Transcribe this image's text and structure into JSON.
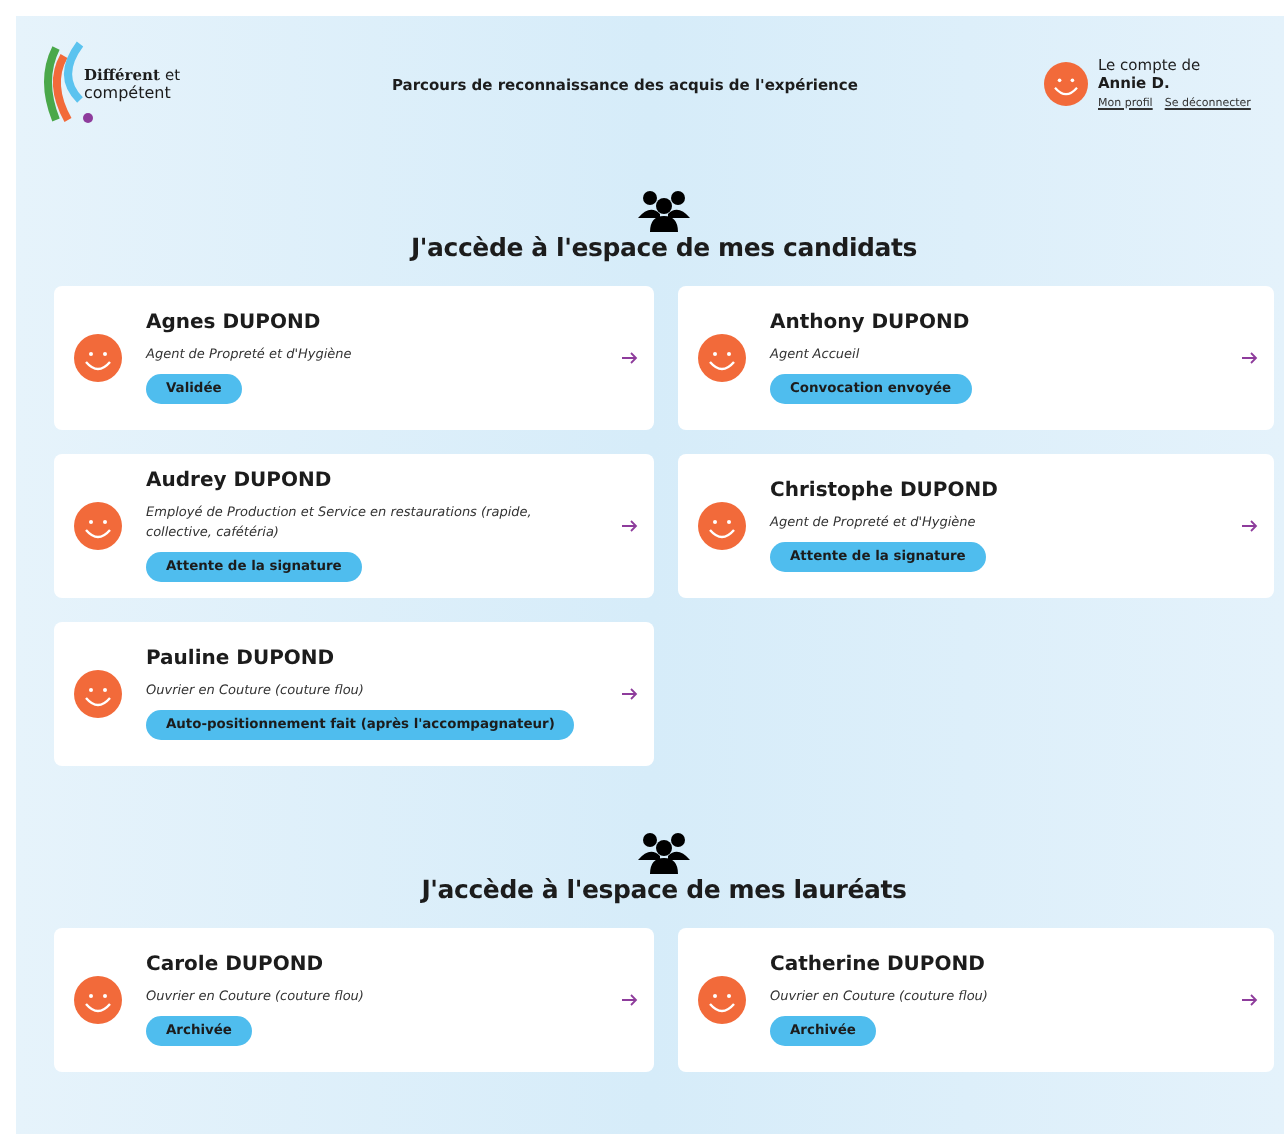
{
  "header": {
    "logo": {
      "line_1": "Différent",
      "line_1_suffix": "et",
      "line_2": "compétent"
    },
    "title": "Parcours de reconnaissance des acquis de l'expérience",
    "account": {
      "caption": "Le compte de",
      "name": "Annie D.",
      "links": [
        "Mon profil",
        "Se déconnecter"
      ]
    }
  },
  "sections": [
    {
      "title": "J'accède à l'espace de mes candidats",
      "cards": [
        {
          "name": "Agnes DUPOND",
          "job": "Agent de Propreté et d'Hygiène",
          "status": "Validée"
        },
        {
          "name": "Anthony DUPOND",
          "job": "Agent Accueil",
          "status": "Convocation envoyée"
        },
        {
          "name": "Audrey DUPOND",
          "job": "Employé de Production et Service en restaurations (rapide, collective, cafétéria)",
          "status": "Attente de la signature"
        },
        {
          "name": "Christophe DUPOND",
          "job": "Agent de Propreté et d'Hygiène",
          "status": "Attente de la signature"
        },
        {
          "name": "Pauline DUPOND",
          "job": "Ouvrier en Couture (couture flou)",
          "status": "Auto-positionnement fait (après l'accompagnateur)"
        }
      ]
    },
    {
      "title": "J'accède à l'espace de mes lauréats",
      "cards": [
        {
          "name": "Carole DUPOND",
          "job": "Ouvrier en Couture (couture flou)",
          "status": "Archivée"
        },
        {
          "name": "Catherine DUPOND",
          "job": "Ouvrier en Couture (couture flou)",
          "status": "Archivée"
        }
      ]
    }
  ]
}
